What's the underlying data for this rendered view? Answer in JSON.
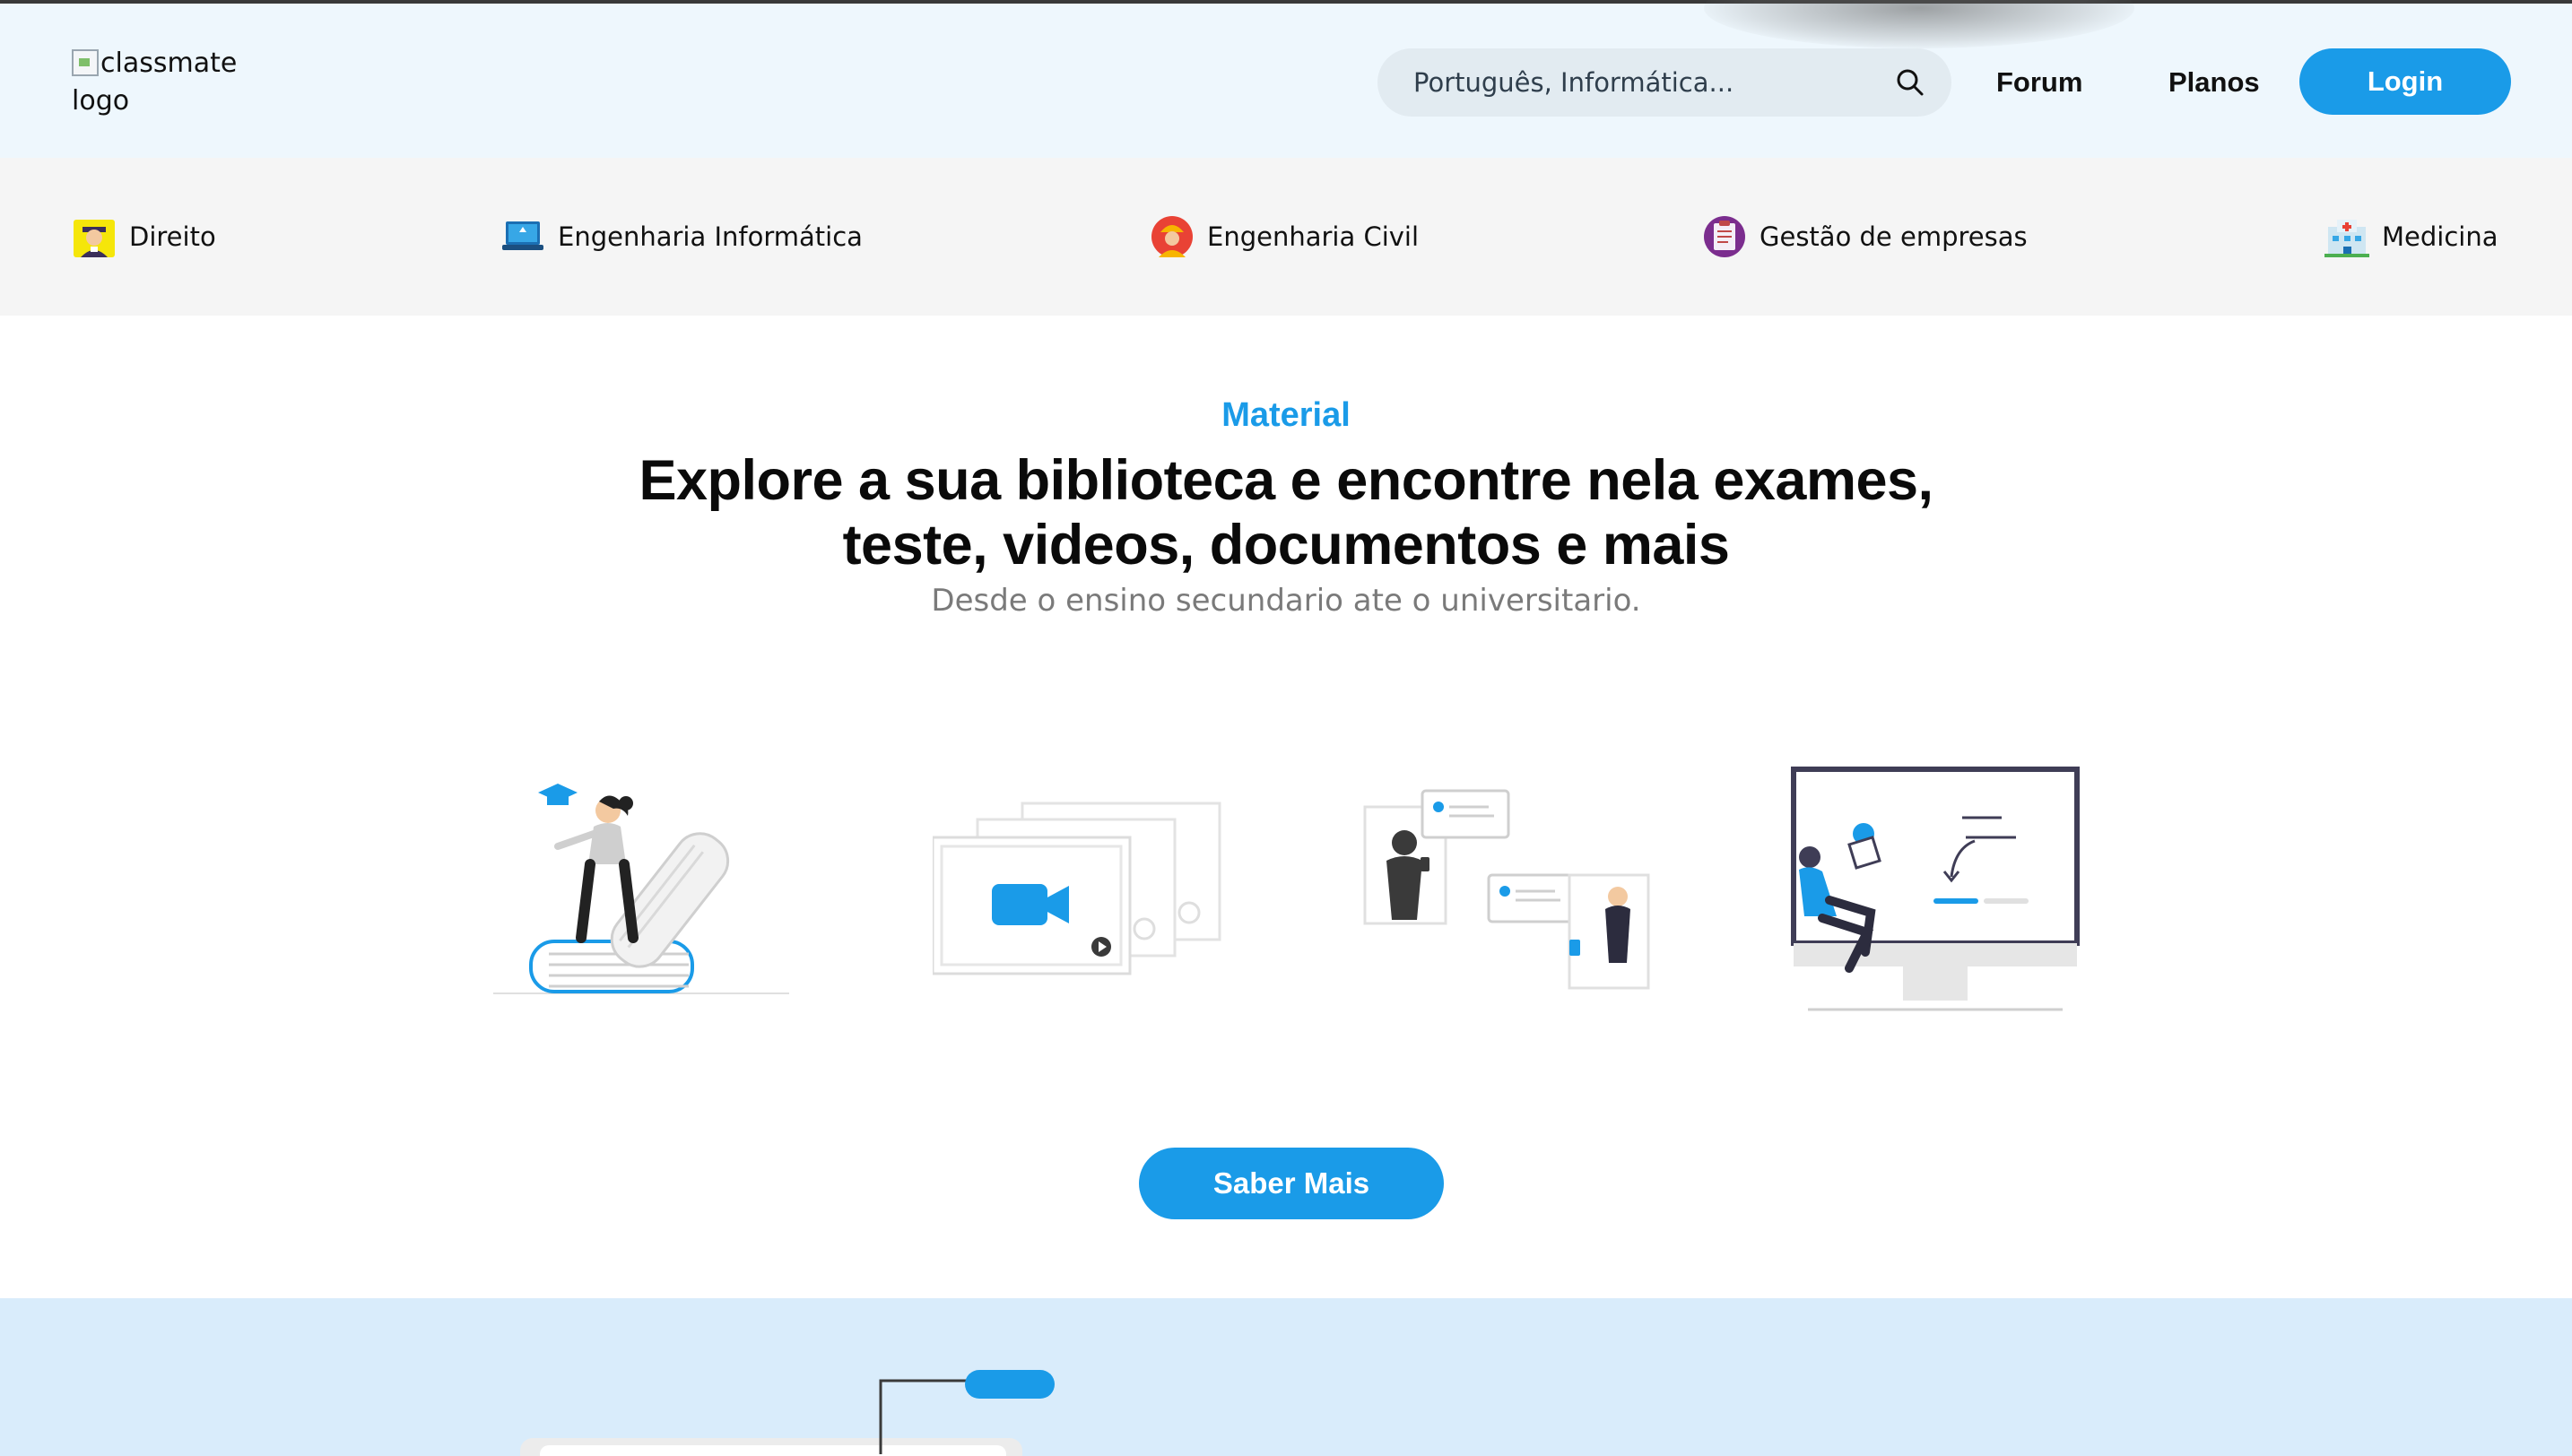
{
  "header": {
    "logo_alt": "classmate logo",
    "search_placeholder": "Português, Informática...",
    "nav": {
      "forum": "Forum",
      "planos": "Planos",
      "login": "Login"
    }
  },
  "categories": [
    {
      "label": "Direito",
      "icon": "judge-icon"
    },
    {
      "label": "Engenharia Informática",
      "icon": "laptop-icon"
    },
    {
      "label": "Engenharia Civil",
      "icon": "engineer-icon"
    },
    {
      "label": "Gestão de empresas",
      "icon": "clipboard-icon"
    },
    {
      "label": "Medicina",
      "icon": "hospital-icon"
    }
  ],
  "main": {
    "eyebrow": "Material",
    "headline_line1": "Explore a sua biblioteca e encontre nela exames,",
    "headline_line2": "teste, videos, documentos e mais",
    "subline": "Desde o ensino secundario ate o universitario.",
    "cta": "Saber Mais"
  },
  "colors": {
    "accent": "#1a9be8",
    "header_bg": "#eef7fd",
    "category_bg": "#f5f5f5",
    "lower_bg": "#d9ecfb"
  }
}
